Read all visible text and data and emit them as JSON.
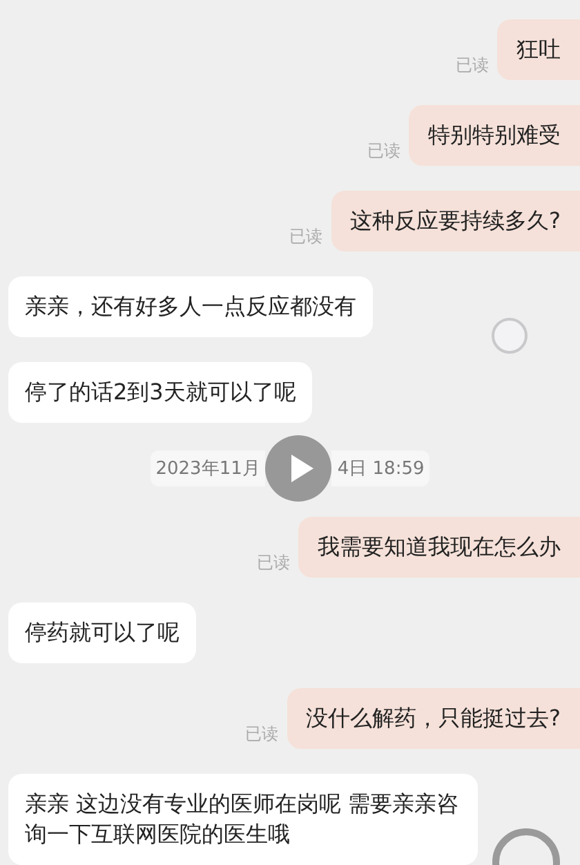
{
  "messages": [
    {
      "kind": "sent",
      "text": "狂吐",
      "status": "已读"
    },
    {
      "kind": "sent",
      "text": "特别特别难受",
      "status": "已读"
    },
    {
      "kind": "sent",
      "text": "这种反应要持续多久?",
      "status": "已读"
    },
    {
      "kind": "received",
      "text": "亲亲，还有好多人一点反应都没有"
    },
    {
      "kind": "received",
      "text": "停了的话2到3天就可以了呢"
    },
    {
      "kind": "time",
      "before": "2023年11月",
      "after": "4日  18:59"
    },
    {
      "kind": "sent",
      "text": "我需要知道我现在怎么办",
      "status": "已读"
    },
    {
      "kind": "received",
      "text": "停药就可以了呢"
    },
    {
      "kind": "sent",
      "text": "没什么解药，只能挺过去?",
      "status": "已读"
    },
    {
      "kind": "received",
      "text": "亲亲  这边没有专业的医师在岗呢  需要亲亲咨询一下互联网医院的医生哦"
    }
  ]
}
